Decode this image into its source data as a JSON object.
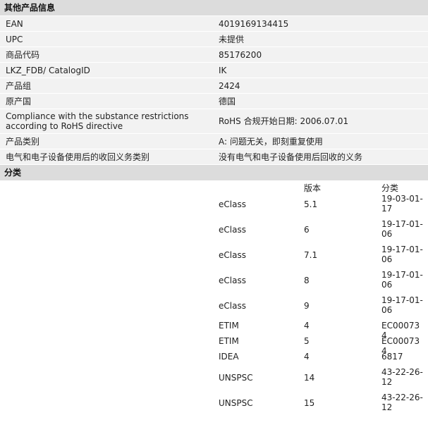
{
  "other_info": {
    "title": "其他产品信息",
    "rows": [
      {
        "label": "EAN",
        "value": "4019169134415"
      },
      {
        "label": "UPC",
        "value": "未提供"
      },
      {
        "label": "商品代码",
        "value": "85176200"
      },
      {
        "label": "LKZ_FDB/ CatalogID",
        "value": "IK"
      },
      {
        "label": "产品组",
        "value": "2424"
      },
      {
        "label": "原产国",
        "value": "德国"
      },
      {
        "label": "Compliance with the substance restrictions according to RoHS directive",
        "value": "RoHS 合规开始日期: 2006.07.01"
      },
      {
        "label": "产品类别",
        "value": "A: 问题无关，即刻重复使用"
      },
      {
        "label": "电气和电子设备使用后的收回义务类别",
        "value": "没有电气和电子设备使用后回收的义务"
      }
    ]
  },
  "classification": {
    "title": "分类",
    "header_version": "版本",
    "header_class": "分类",
    "rows": [
      {
        "system": "eClass",
        "version": "5.1",
        "class": "19-03-01-17"
      },
      {
        "system": "eClass",
        "version": "6",
        "class": "19-17-01-06"
      },
      {
        "system": "eClass",
        "version": "7.1",
        "class": "19-17-01-06"
      },
      {
        "system": "eClass",
        "version": "8",
        "class": "19-17-01-06"
      },
      {
        "system": "eClass",
        "version": "9",
        "class": "19-17-01-06"
      },
      {
        "system": "ETIM",
        "version": "4",
        "class": "EC000734"
      },
      {
        "system": "ETIM",
        "version": "5",
        "class": "EC000734"
      },
      {
        "system": "IDEA",
        "version": "4",
        "class": "6817"
      },
      {
        "system": "UNSPSC",
        "version": "14",
        "class": "43-22-26-12"
      },
      {
        "system": "UNSPSC",
        "version": "15",
        "class": "43-22-26-12"
      }
    ]
  }
}
